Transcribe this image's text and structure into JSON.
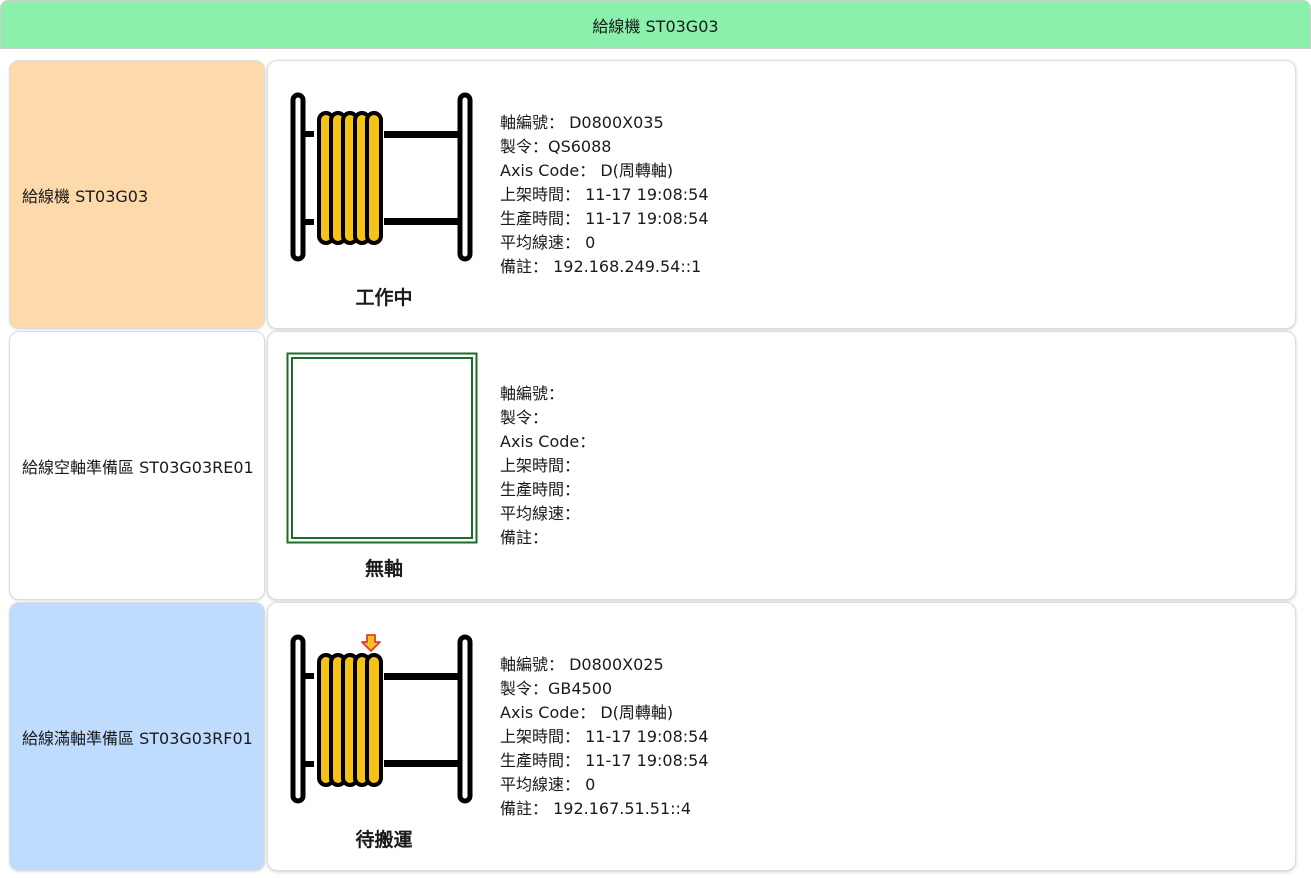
{
  "header": {
    "title": "給線機 ST03G03"
  },
  "colors": {
    "header_bg": "#8af0ab",
    "working_bg": "#fdd9ab",
    "empty_bg": "#ffffff",
    "full_bg": "#bfdbfe",
    "spool_yellow": "#f5c218",
    "frame_green": "#1d6b2a",
    "arrow_red": "#e53935"
  },
  "rows": [
    {
      "label": "給線機 ST03G03",
      "icon": "spool-icon",
      "status": "工作中",
      "info": [
        "軸編號： D0800X035",
        "製令：QS6088",
        "Axis Code： D(周轉軸)",
        "上架時間： 11-17 19:08:54",
        "生產時間： 11-17 19:08:54",
        "平均線速： 0",
        "備註： 192.168.249.54::1"
      ]
    },
    {
      "label": "給線空軸準備區 ST03G03RE01",
      "icon": "empty-slot-icon",
      "status": "無軸",
      "info": [
        "軸編號：",
        "製令：",
        "Axis Code：",
        "上架時間：",
        "生產時間：",
        "平均線速：",
        "備註："
      ]
    },
    {
      "label": "給線滿軸準備區 ST03G03RF01",
      "icon": "spool-with-arrow-icon",
      "status": "待搬運",
      "info": [
        "軸編號： D0800X025",
        "製令：GB4500",
        "Axis Code： D(周轉軸)",
        "上架時間： 11-17 19:08:54",
        "生產時間： 11-17 19:08:54",
        "平均線速： 0",
        "備註： 192.167.51.51::4"
      ]
    }
  ]
}
